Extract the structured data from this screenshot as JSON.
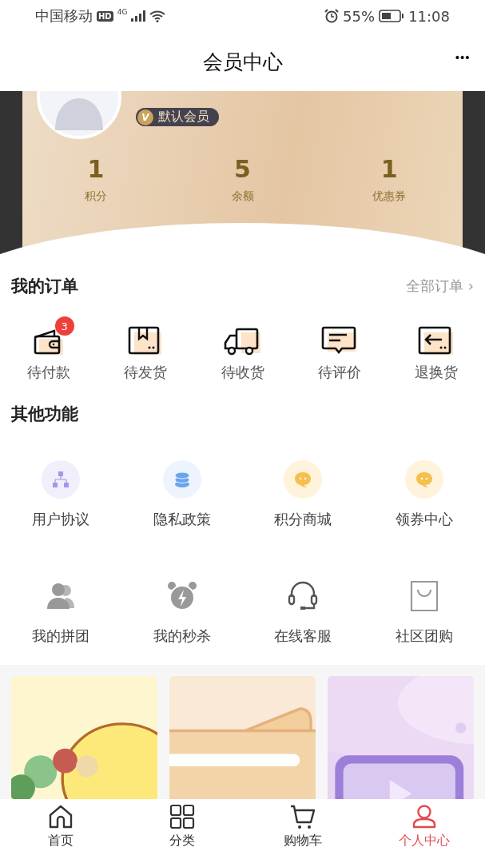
{
  "status_bar": {
    "carrier": "中国移动",
    "hd": "HD",
    "network": "4G",
    "battery_percent": "55%",
    "time": "11:08"
  },
  "header": {
    "title": "会员中心",
    "more": "•••"
  },
  "member": {
    "badge": "默认会员",
    "badge_mark": "V",
    "stats": [
      {
        "value": "1",
        "label": "积分"
      },
      {
        "value": "5",
        "label": "余额"
      },
      {
        "value": "1",
        "label": "优惠券"
      }
    ]
  },
  "orders": {
    "title": "我的订单",
    "all_link": "全部订单",
    "chevron": "›",
    "items": [
      {
        "label": "待付款",
        "kind": "wallet",
        "badge": "3"
      },
      {
        "label": "待发货",
        "kind": "box"
      },
      {
        "label": "待收货",
        "kind": "truck"
      },
      {
        "label": "待评价",
        "kind": "message"
      },
      {
        "label": "退换货",
        "kind": "return"
      }
    ]
  },
  "features": {
    "title": "其他功能",
    "items": [
      {
        "label": "用户协议",
        "kind": "org"
      },
      {
        "label": "隐私政策",
        "kind": "stack"
      },
      {
        "label": "积分商城",
        "kind": "chat"
      },
      {
        "label": "领券中心",
        "kind": "chat"
      },
      {
        "label": "我的拼团",
        "kind": "group"
      },
      {
        "label": "我的秒杀",
        "kind": "alarm"
      },
      {
        "label": "在线客服",
        "kind": "headset"
      },
      {
        "label": "社区团购",
        "kind": "bag"
      }
    ]
  },
  "tab_bar": [
    {
      "label": "首页",
      "kind": "home",
      "selected": false
    },
    {
      "label": "分类",
      "kind": "grid",
      "selected": false
    },
    {
      "label": "购物车",
      "kind": "cart",
      "selected": false
    },
    {
      "label": "个人中心",
      "kind": "person",
      "selected": true
    }
  ]
}
